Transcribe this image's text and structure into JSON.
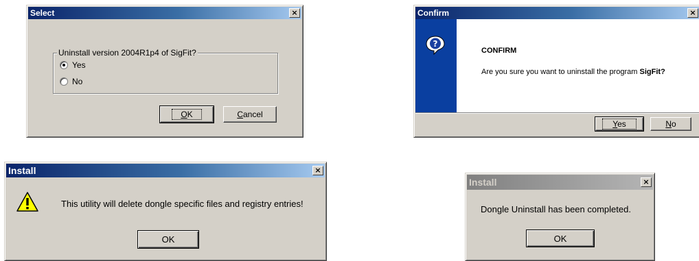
{
  "select_dialog": {
    "title": "Select",
    "group_label": "Uninstall version 2004R1p4 of SigFit?",
    "options": [
      {
        "label": "Yes",
        "selected": true
      },
      {
        "label": "No",
        "selected": false
      }
    ],
    "ok_accel": "O",
    "ok_rest": "K",
    "cancel_accel": "C",
    "cancel_rest": "ancel"
  },
  "confirm_dialog": {
    "title": "Confirm",
    "heading": "CONFIRM",
    "message_prefix": "Are you sure you want to uninstall the program ",
    "program_name": "SigFit?",
    "yes_accel": "Y",
    "yes_rest": "es",
    "no_accel": "N",
    "no_rest": "o",
    "icon": "question-icon",
    "side_color": "#0a3fa0"
  },
  "install_warning_dialog": {
    "title": "Install",
    "message": "This utility will delete dongle specific files and registry entries!",
    "ok_label": "OK",
    "icon": "warning-icon"
  },
  "install_done_dialog": {
    "title": "Install",
    "message": "Dongle Uninstall has been completed.",
    "ok_label": "OK"
  },
  "close_glyph": "×"
}
